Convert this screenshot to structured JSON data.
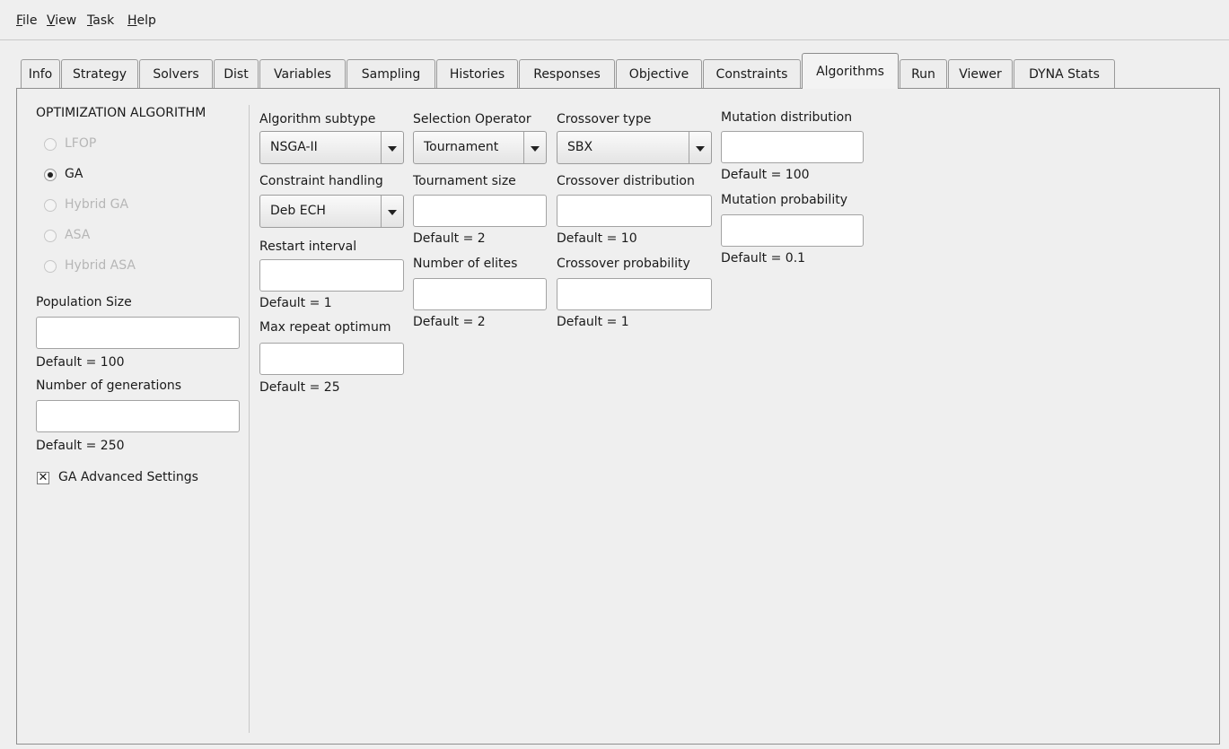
{
  "menu": {
    "file": {
      "m": "F",
      "rest": "ile"
    },
    "view": {
      "m": "V",
      "rest": "iew"
    },
    "task": {
      "m": "T",
      "rest": "ask"
    },
    "help": {
      "m": "H",
      "rest": "elp"
    }
  },
  "tabs": [
    "Info",
    "Strategy",
    "Solvers",
    "Dist",
    "Variables",
    "Sampling",
    "Histories",
    "Responses",
    "Objective",
    "Constraints",
    "Algorithms",
    "Run",
    "Viewer",
    "DYNA Stats"
  ],
  "active_tab": "Algorithms",
  "left": {
    "heading": "OPTIMIZATION ALGORITHM",
    "radios": [
      "LFOP",
      "GA",
      "Hybrid GA",
      "ASA",
      "Hybrid ASA"
    ],
    "selected": "GA",
    "population_label": "Population Size",
    "population_value": "",
    "population_default": "Default = 100",
    "generations_label": "Number of generations",
    "generations_value": "",
    "generations_default": "Default = 250",
    "advanced_label": "GA Advanced Settings",
    "advanced_checked": true
  },
  "col1": {
    "subtype_label": "Algorithm subtype",
    "subtype_value": "NSGA-II",
    "constraint_label": "Constraint handling",
    "constraint_value": "Deb ECH",
    "restart_label": "Restart interval",
    "restart_value": "",
    "restart_default": "Default = 1",
    "maxrepeat_label": "Max repeat optimum",
    "maxrepeat_value": "",
    "maxrepeat_default": "Default = 25"
  },
  "col2": {
    "selection_label": "Selection Operator",
    "selection_value": "Tournament",
    "tsize_label": "Tournament size",
    "tsize_value": "",
    "tsize_default": "Default = 2",
    "elites_label": "Number of elites",
    "elites_value": "",
    "elites_default": "Default = 2"
  },
  "col3": {
    "crossover_label": "Crossover type",
    "crossover_value": "SBX",
    "cdist_label": "Crossover distribution",
    "cdist_value": "",
    "cdist_default": "Default = 10",
    "cprob_label": "Crossover probability",
    "cprob_value": "",
    "cprob_default": "Default = 1"
  },
  "col4": {
    "mdist_label": "Mutation distribution",
    "mdist_value": "",
    "mdist_default": "Default = 100",
    "mprob_label": "Mutation probability",
    "mprob_value": "",
    "mprob_default": "Default = 0.1"
  }
}
